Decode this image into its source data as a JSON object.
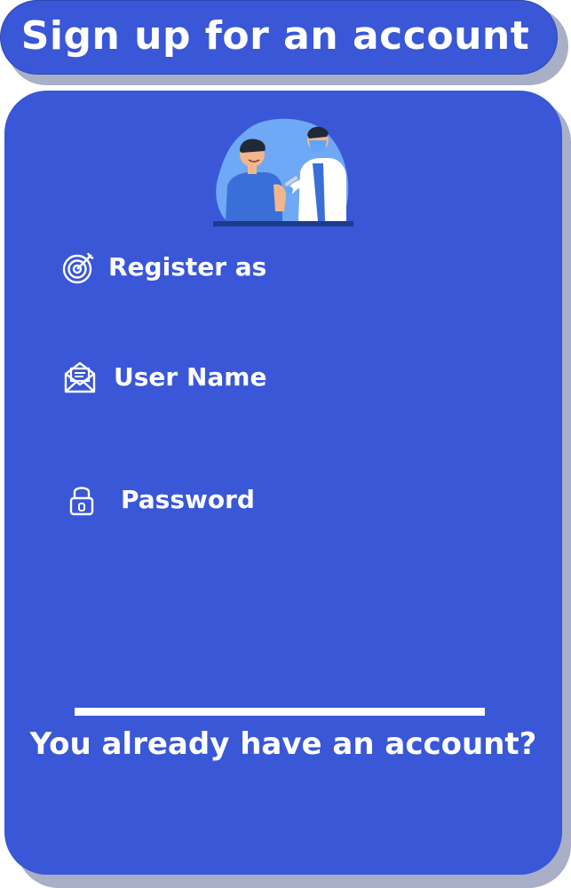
{
  "header": {
    "title": "Sign up for an account"
  },
  "form": {
    "fields": [
      {
        "label": "Register as",
        "icon": "target-icon"
      },
      {
        "label": "User Name",
        "icon": "envelope-icon"
      },
      {
        "label": "Password",
        "icon": "lock-icon"
      }
    ]
  },
  "footer": {
    "login_prompt": "You already have an account?"
  },
  "colors": {
    "primary": "#3957d7",
    "shadow": "#a9afc7",
    "text": "#ffffff"
  }
}
